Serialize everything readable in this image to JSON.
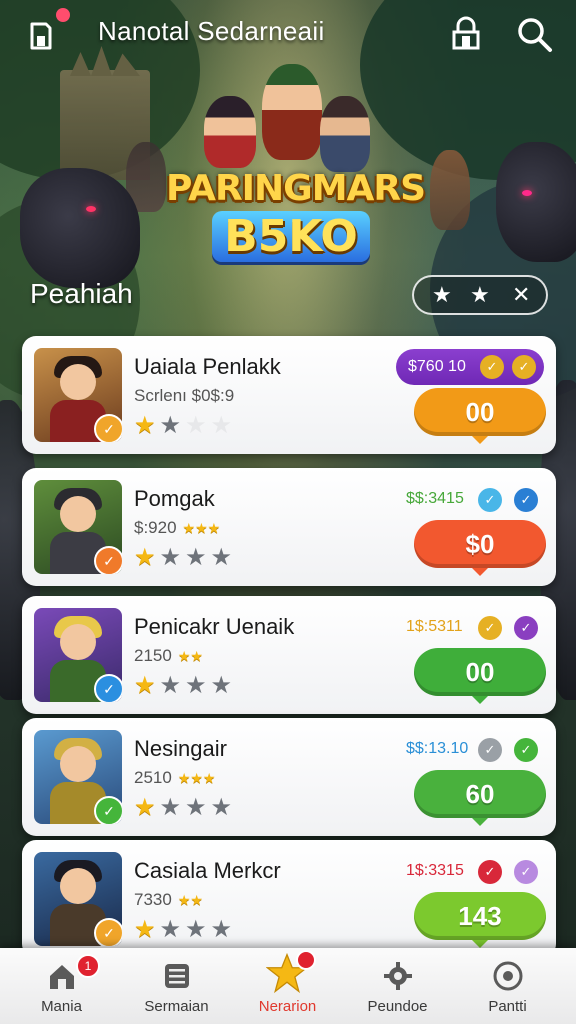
{
  "header": {
    "title": "Nanotal Sedarneaii",
    "notif_count": "",
    "icons": [
      "saved-icon",
      "shop-icon",
      "search-icon"
    ]
  },
  "banner": {
    "logo_line1": "PARINGMARS",
    "logo_line2": "B5KO"
  },
  "section": {
    "title": "Peahiah",
    "rating_filter": {
      "stars_on": 2,
      "close_symbol": "✕"
    }
  },
  "items": [
    {
      "title": "Uaiala Penlakk",
      "subtitle": "Scrlenı $0$:9",
      "mini_rating": "",
      "price": "$760 10",
      "price_color": "#ffffff",
      "price_style": "chip",
      "action_label": "00",
      "action_color": "#f29a17",
      "stars": 2,
      "thumb_badge_color": "#f0a52a"
    },
    {
      "title": "Pomgak",
      "subtitle": "$:920",
      "mini_rating": "★★★",
      "price": "$$:3415",
      "price_color": "#47a83a",
      "price_style": "text",
      "action_label": "$0",
      "action_color": "#f2582f",
      "stars": 4,
      "thumb_badge_color": "#f07a2a"
    },
    {
      "title": "Penicakr Uenaik",
      "subtitle": "2150",
      "mini_rating": "★★",
      "price": "1$:5311",
      "price_color": "#e2a21a",
      "price_style": "text",
      "action_label": "00",
      "action_color": "#3fae3a",
      "stars": 4,
      "thumb_badge_color": "#2b8fe0"
    },
    {
      "title": "Nesingair",
      "subtitle": "2510",
      "mini_rating": "★★★",
      "price": "$$:13.10",
      "price_color": "#2a8fd6",
      "price_style": "text",
      "action_label": "60",
      "action_color": "#49b13d",
      "stars": 4,
      "thumb_badge_color": "#45b53b"
    },
    {
      "title": "Casiala Merkcr",
      "subtitle": "7330",
      "mini_rating": "★★",
      "price": "1$:3315",
      "price_color": "#d8283a",
      "price_style": "text",
      "action_label": "143",
      "action_color": "#7cc92e",
      "stars": 4,
      "thumb_badge_color": "#f0a52a"
    }
  ],
  "nav": [
    {
      "label": "Mania",
      "icon": "home-icon",
      "badge": "1"
    },
    {
      "label": "Sermaian",
      "icon": "list-icon",
      "badge": ""
    },
    {
      "label": "Nerarion",
      "icon": "star-icon",
      "badge": "",
      "active": true
    },
    {
      "label": "Peundoe",
      "icon": "gear-icon",
      "badge": ""
    },
    {
      "label": "Pantti",
      "icon": "disc-icon",
      "badge": ""
    }
  ],
  "colors": {
    "accent": "#e0392e",
    "card_bg": "#ffffff",
    "price_chip": "#7a30c0",
    "star_on": "#f5b814",
    "star_off": "#6e737a"
  }
}
